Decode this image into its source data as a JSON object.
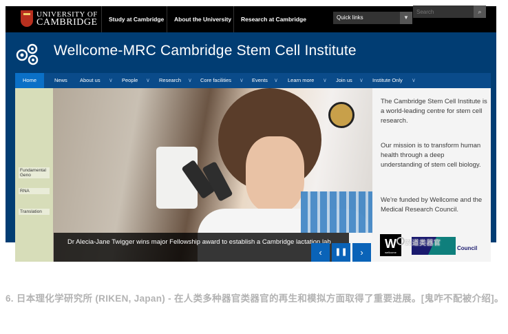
{
  "header": {
    "university_line1": "UNIVERSITY OF",
    "university_line2": "CAMBRIDGE",
    "nav": [
      "Study at Cambridge",
      "About the University",
      "Research at Cambridge"
    ],
    "quick_links": "Quick links",
    "search_placeholder": "Search"
  },
  "institute": {
    "title": "Wellcome-MRC Cambridge Stem Cell Institute"
  },
  "main_nav": {
    "items": [
      "Home",
      "News",
      "About us",
      "People",
      "Research",
      "Core facilities",
      "Events",
      "Learn more",
      "Join us",
      "Institute Only"
    ],
    "active": "Home"
  },
  "hero": {
    "caption": "Dr Alecia-Jane Twigger wins major Fellowship award to establish a Cambridge lactation lab",
    "lab_tags": [
      "Fundamental Geno",
      "RNA",
      "Translation"
    ]
  },
  "side_panel": {
    "paragraphs": [
      "The Cambridge Stem Cell Institute is a world-leading centre for stem cell research.",
      "Our mission is to transform human health through a deep understanding of stem cell biology.",
      "We're funded by Wellcome and the Medical Research Council."
    ],
    "funder_wellcome": "W",
    "funder_wellcome_sub": "wellcome",
    "funder_mrc": "Council"
  },
  "watermark": "肠道类器官",
  "article": {
    "text": "6. 日本理化学研究所 (RIKEN, Japan) - 在人类多种器官类器官的再生和模拟方面取得了重要进展。[鬼咋不配被介绍]。"
  },
  "colors": {
    "top_bar": "#000000",
    "banner": "#013d73",
    "nav_bar": "#0a4b8a",
    "nav_active": "#0a70c7",
    "control": "#0a63b8"
  }
}
